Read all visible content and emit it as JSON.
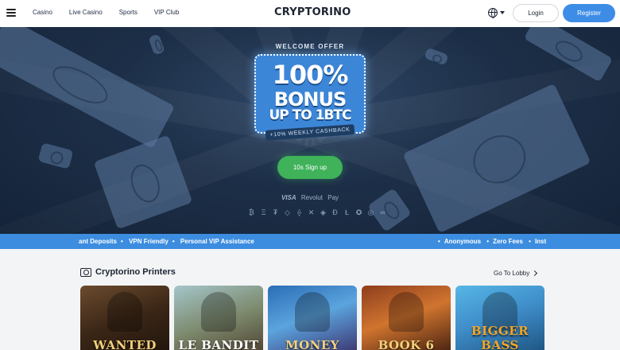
{
  "header": {
    "menu_icon": "hamburger-icon",
    "nav": [
      "Casino",
      "Live Casino",
      "Sports",
      "VIP Club"
    ],
    "logo": "CRYPTORINO",
    "language_icon": "globe-icon",
    "login_label": "Login",
    "register_label": "Register"
  },
  "hero": {
    "welcome": "WELCOME OFFER",
    "bonus_line1": "100%",
    "bonus_line2": "BONUS",
    "bonus_line3": "UP TO 1BTC",
    "cashback": "+10% WEEKLY CASHBACK",
    "signup_label": "10s Sign up",
    "payments": [
      "VISA",
      "Revolut",
      "Pay"
    ],
    "crypto_icons": [
      "₿",
      "Ξ",
      "₮",
      "◇",
      "⟠",
      "✕",
      "◈",
      "Ð",
      "Ł",
      "✪",
      "◎",
      "∞"
    ]
  },
  "ticker": {
    "left": [
      "ant Deposits",
      "VPN Friendly",
      "Personal VIP Assistance"
    ],
    "right": [
      "Anonymous",
      "Zero Fees",
      "Inst"
    ]
  },
  "section": {
    "title": "Cryptorino Printers",
    "lobby_link": "Go To Lobby",
    "games": [
      {
        "title": "WANTED"
      },
      {
        "title": "LE BANDIT"
      },
      {
        "title": "MONEY"
      },
      {
        "title": "BOOK 6"
      },
      {
        "title": "BIGGER BASS"
      }
    ]
  },
  "colors": {
    "accent_blue": "#3c8de0",
    "signup_green": "#3fb25a",
    "hero_dark": "#1d2f48"
  }
}
